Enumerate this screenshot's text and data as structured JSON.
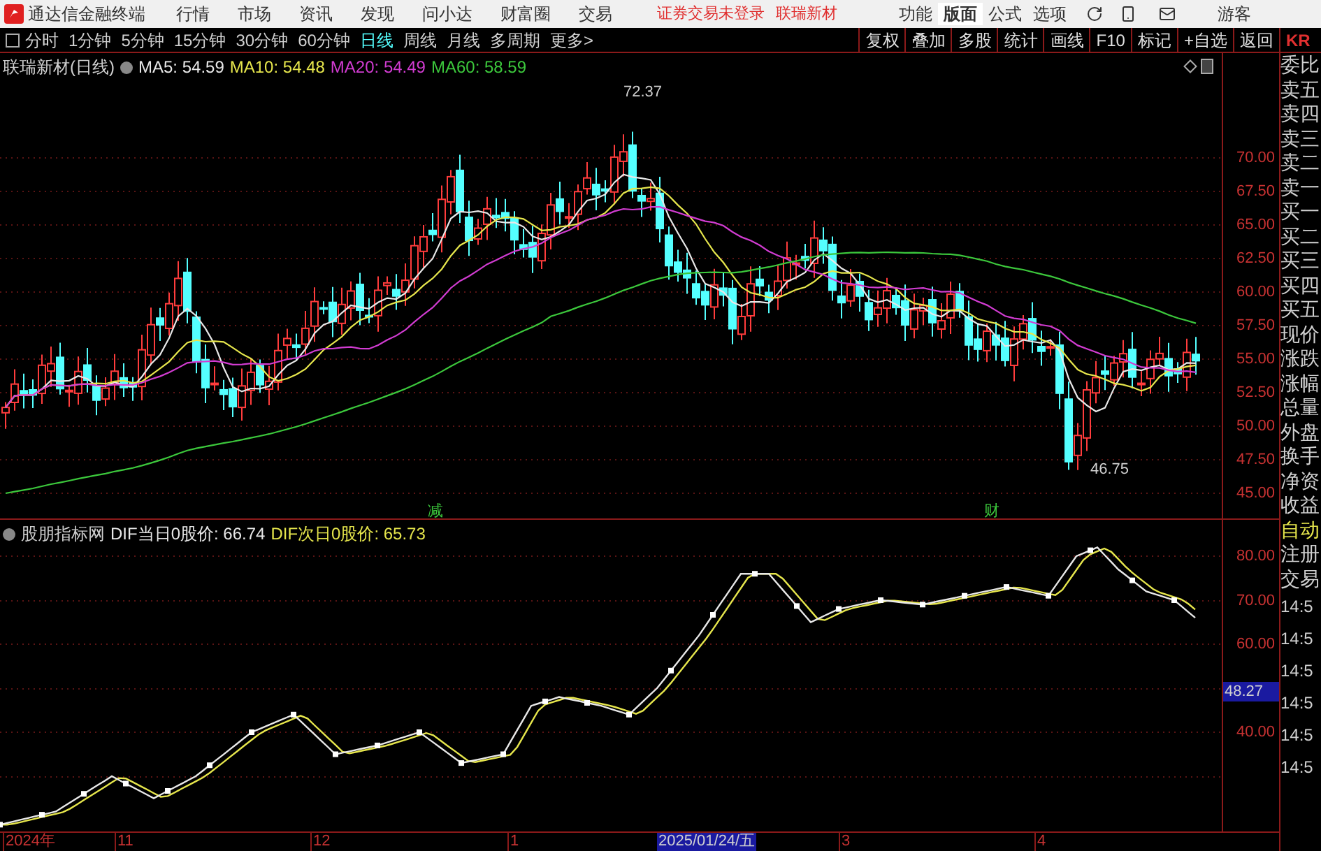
{
  "app_bar": {
    "title": "通达信金融终端",
    "menus": [
      "行情",
      "市场",
      "资讯",
      "发现",
      "问小达",
      "财富圈",
      "交易"
    ],
    "notices": [
      "证券交易未登录",
      "联瑞新材"
    ],
    "right_menus": [
      {
        "label": "功能",
        "selected": false
      },
      {
        "label": "版面",
        "selected": true
      },
      {
        "label": "公式",
        "selected": false
      },
      {
        "label": "选项",
        "selected": false
      }
    ],
    "user": "游客"
  },
  "toolbar": {
    "periods": [
      {
        "label": "分时",
        "selected": false
      },
      {
        "label": "1分钟",
        "selected": false
      },
      {
        "label": "5分钟",
        "selected": false
      },
      {
        "label": "15分钟",
        "selected": false
      },
      {
        "label": "30分钟",
        "selected": false
      },
      {
        "label": "60分钟",
        "selected": false
      },
      {
        "label": "日线",
        "selected": true
      },
      {
        "label": "周线",
        "selected": false
      },
      {
        "label": "月线",
        "selected": false
      },
      {
        "label": "多周期",
        "selected": false
      },
      {
        "label": "更多>",
        "selected": false
      }
    ],
    "actions": [
      "复权",
      "叠加",
      "多股",
      "统计",
      "画线",
      "F10",
      "标记",
      "+自选",
      "返回"
    ],
    "code": "KR"
  },
  "price_chart": {
    "title": "联瑞新材(日线)",
    "ma": [
      {
        "label": "MA5: 54.59",
        "color": "#e8e8e8"
      },
      {
        "label": "MA10: 54.48",
        "color": "#e6e64c"
      },
      {
        "label": "MA20: 54.49",
        "color": "#d23cd2"
      },
      {
        "label": "MA60: 58.59",
        "color": "#3cc83c"
      }
    ],
    "high_label": "72.37",
    "low_label": "46.75",
    "markers": [
      "减",
      "财"
    ],
    "yticks": [
      "70.00",
      "67.50",
      "65.00",
      "62.50",
      "60.00",
      "57.50",
      "55.00",
      "52.50",
      "50.00",
      "47.50",
      "45.00"
    ]
  },
  "indicator": {
    "title": "股朋指标网",
    "lines": [
      {
        "label": "DIF当日0股价: 66.74",
        "color": "#e8e8e8"
      },
      {
        "label": "DIF次日0股价: 65.73",
        "color": "#e6e64c"
      }
    ],
    "yticks": [
      "80.00",
      "70.00",
      "60.00",
      "40.00"
    ],
    "cursor_value": "48.27"
  },
  "quote_panel": {
    "labels": [
      "委比",
      "卖五",
      "卖四",
      "卖三",
      "卖二",
      "卖一",
      "买一",
      "买二",
      "买三",
      "买四",
      "买五",
      "现价",
      "涨跌",
      "涨幅",
      "总量",
      "外盘",
      "换手",
      "净资",
      "收益",
      "自动",
      "注册",
      "交易"
    ],
    "times": [
      "14:5",
      "14:5",
      "14:5",
      "14:5",
      "14:5",
      "14:5"
    ]
  },
  "date_axis": {
    "labels": [
      "2024年",
      "11",
      "12",
      "1",
      "3",
      "4"
    ],
    "cursor_date": "2025/01/24/五"
  }
}
